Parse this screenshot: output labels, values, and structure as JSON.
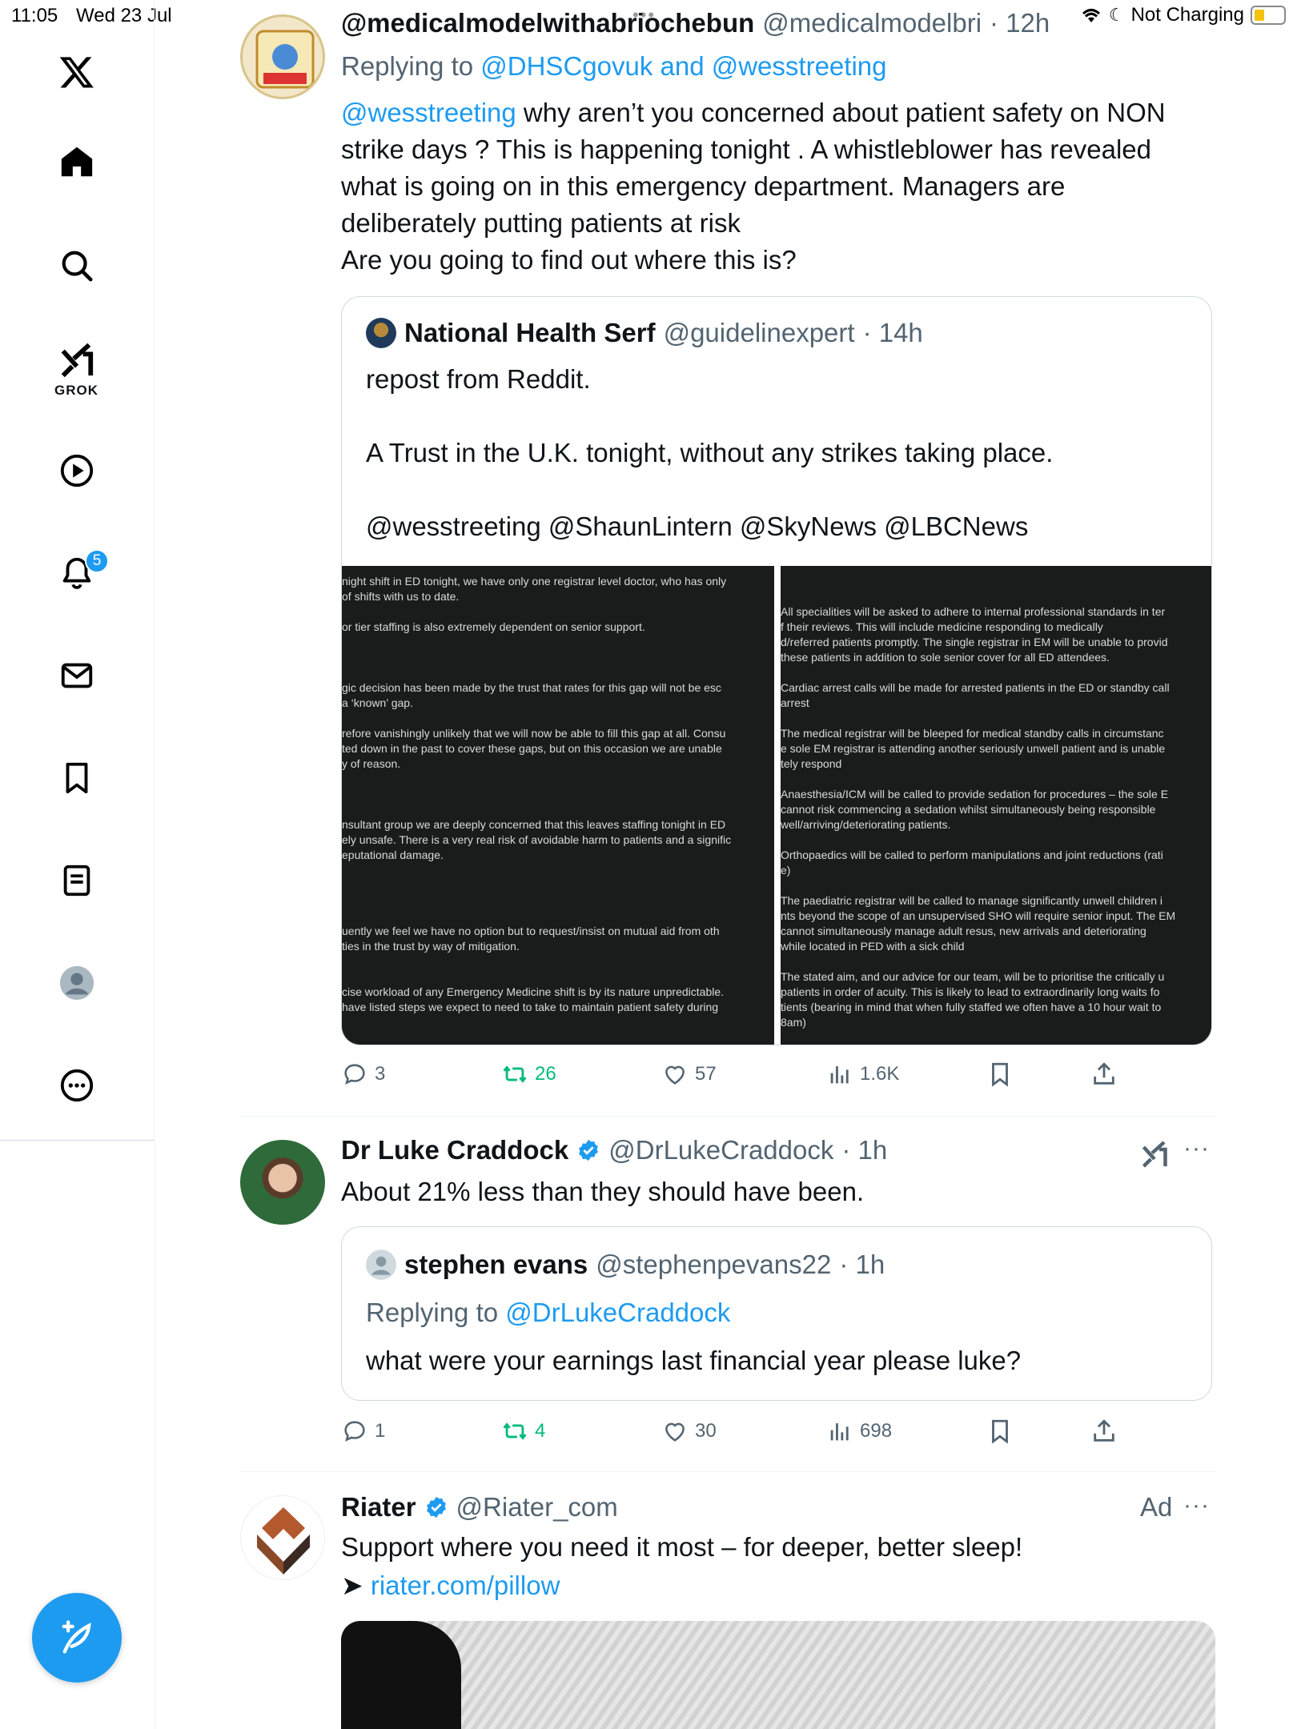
{
  "status_bar": {
    "time": "11:05",
    "date": "Wed 23 Jul",
    "charging": "Not Charging"
  },
  "sidebar": {
    "logo": "x-logo-icon",
    "items": [
      {
        "name": "home",
        "icon": "home-icon"
      },
      {
        "name": "search",
        "icon": "search-icon"
      },
      {
        "name": "grok",
        "icon": "grok-icon",
        "label": "GROK"
      },
      {
        "name": "video",
        "icon": "play-icon"
      },
      {
        "name": "notifications",
        "icon": "bell-icon",
        "badge": "5"
      },
      {
        "name": "messages",
        "icon": "mail-icon"
      },
      {
        "name": "bookmarks",
        "icon": "bookmark-icon"
      },
      {
        "name": "lists",
        "icon": "list-icon"
      },
      {
        "name": "profile",
        "icon": "profile-icon"
      },
      {
        "name": "more",
        "icon": "more-circle-icon"
      }
    ],
    "compose": "compose-icon"
  },
  "tweets": [
    {
      "name": "@medicalmodelwithabriochebun",
      "handle": "@medicalmodelbri",
      "time": "· 12h",
      "replying_prefix": "Replying to ",
      "replying_to": "@DHSCgovuk and @wesstreeting",
      "mention": "@wesstreeting",
      "text_lines": [
        " why  aren’t you concerned about patient safety on NON",
        "strike days ? This is happening tonight . A whistleblower has revealed",
        "what is going on in this emergency department. Managers are",
        "deliberately putting patients at risk",
        "Are you going to find out where this is?"
      ],
      "quote": {
        "name": "National Health Serf",
        "handle": "@guidelinexpert",
        "time": "· 14h",
        "text_lines": [
          "repost from Reddit.",
          "",
          "A Trust in the U.K. tonight, without any strikes taking place.",
          "",
          "@wesstreeting @ShaunLintern @SkyNews @LBCNews"
        ],
        "image_left_lines": [
          "night shift in ED tonight, we have only one registrar level doctor, who has only",
          " of shifts with us to date.",
          "",
          "or tier staffing is also  extremely dependent on senior support.",
          "",
          "",
          "",
          "gic decision has been made by the trust that rates for this gap will not be esc",
          "a ‘known’ gap.",
          "",
          "refore vanishingly unlikely that we will now be able to fill this gap at all. Consu",
          "ted down in the past to cover these gaps, but on this occasion we are unable",
          "y of reason.",
          "",
          "",
          "",
          "nsultant group we are deeply concerned that this leaves staffing tonight in ED",
          "ely unsafe. There is a very real risk of avoidable harm to patients and a signific",
          "eputational damage.",
          "",
          "",
          "",
          "",
          "uently we feel we have no option but to request/insist on mutual aid from oth",
          "ties in the trust by way of mitigation.",
          "",
          "",
          "cise workload of any Emergency Medicine shift is by its nature unpredictable.",
          " have listed steps we expect to need to take to maintain patient safety during"
        ],
        "image_right_lines": [
          "",
          "",
          "All specialities will be asked to adhere to internal professional standards in ter",
          "f their reviews. This will include medicine responding to medically",
          "d/referred patients promptly. The single registrar in EM will be unable to provid",
          " these patients in addition to sole senior cover for all ED attendees.",
          "",
          "Cardiac arrest calls will be made for arrested patients in the ED or standby call",
          "arrest",
          "",
          "The medical registrar will be bleeped for medical standby calls in circumstanc",
          "e sole EM registrar is attending another seriously unwell patient and is unable",
          "tely respond",
          "",
          "Anaesthesia/ICM will be called to provide sedation for procedures – the sole E",
          " cannot risk commencing a sedation whilst simultaneously being responsible",
          "well/arriving/deteriorating patients.",
          "",
          "Orthopaedics will be called to perform manipulations and joint reductions (rati",
          "e)",
          "",
          "The paediatric registrar will be called to manage significantly unwell children i",
          "nts beyond the scope of an unsupervised SHO will require senior input. The EM",
          " cannot simultaneously manage adult resus, new arrivals and deteriorating",
          " while located in PED with a sick child",
          "",
          "The stated aim, and our advice for our team, will be to prioritise the critically u",
          "patients in order of acuity. This is likely to lead to extraordinarily long waits fo",
          "tients (bearing in mind that when fully staffed we often have a 10 hour wait to",
          "8am)"
        ]
      },
      "actions": {
        "replies": "3",
        "reposts": "26",
        "likes": "57",
        "views": "1.6K"
      }
    },
    {
      "name": "Dr Luke Craddock",
      "handle": "@DrLukeCraddock",
      "time": "· 1h",
      "text": "About 21% less than they should have been.",
      "quote": {
        "name": "stephen evans",
        "handle": "@stephenpevans22",
        "time": "· 1h",
        "replying_prefix": "Replying to ",
        "replying_to": "@DrLukeCraddock",
        "text": "what were your earnings last financial year please luke?"
      },
      "actions": {
        "replies": "1",
        "reposts": "4",
        "likes": "30",
        "views": "698"
      }
    },
    {
      "name": "Riater",
      "handle": "@Riater_com",
      "ad_label": "Ad",
      "text": "Support where you need it most – for deeper, better sleep!",
      "link_arrow": "➤ ",
      "link": "riater.com/pillow"
    }
  ],
  "colors": {
    "accent": "#1d9bf0",
    "repost": "#00ba7c",
    "muted": "#536471",
    "text": "#0f1419"
  }
}
